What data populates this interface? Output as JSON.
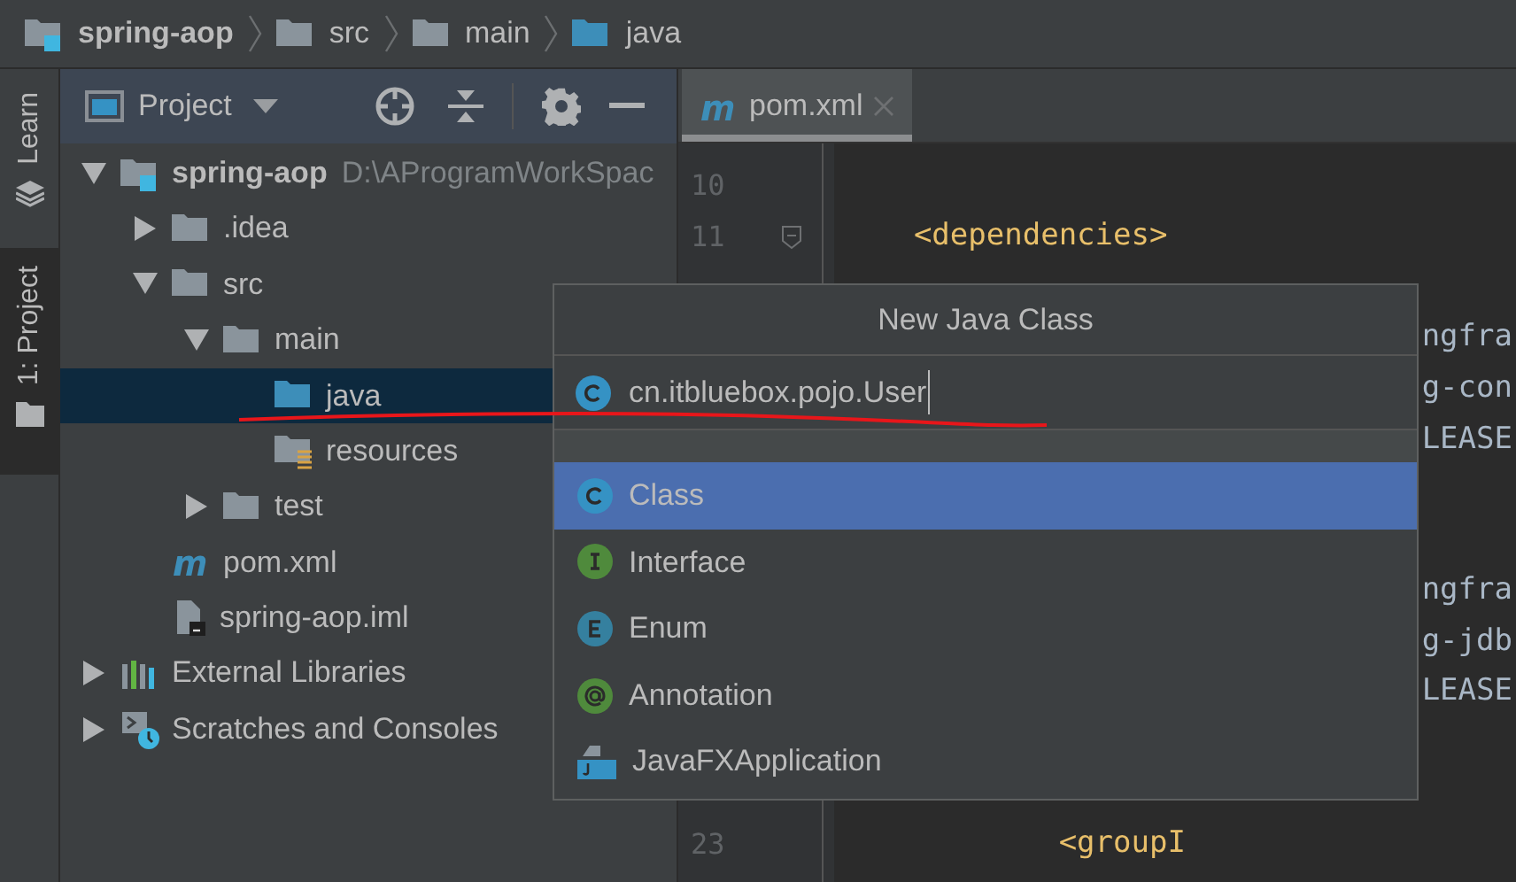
{
  "breadcrumbs": [
    {
      "label": "spring-aop",
      "kind": "module"
    },
    {
      "label": "src",
      "kind": "folder"
    },
    {
      "label": "main",
      "kind": "folder"
    },
    {
      "label": "java",
      "kind": "source"
    }
  ],
  "side_tabs": [
    {
      "label": "Learn",
      "kind": "learn",
      "selected": false
    },
    {
      "label": "1: Project",
      "kind": "project",
      "selected": true
    }
  ],
  "project_panel": {
    "title": "Project",
    "tree": [
      {
        "label": "spring-aop",
        "path": "D:\\AProgramWorkSpac",
        "kind": "module",
        "expanded": true,
        "selected": false,
        "children": [
          {
            "label": ".idea",
            "kind": "folder",
            "expanded": false,
            "selected": false
          },
          {
            "label": "src",
            "kind": "folder",
            "expanded": true,
            "selected": false,
            "children": [
              {
                "label": "main",
                "kind": "folder",
                "expanded": true,
                "selected": false,
                "children": [
                  {
                    "label": "java",
                    "kind": "source",
                    "selected": true
                  },
                  {
                    "label": "resources",
                    "kind": "resources",
                    "selected": false
                  }
                ]
              },
              {
                "label": "test",
                "kind": "folder",
                "expanded": false,
                "selected": false
              }
            ]
          },
          {
            "label": "pom.xml",
            "kind": "maven",
            "selected": false
          },
          {
            "label": "spring-aop.iml",
            "kind": "iml",
            "selected": false
          }
        ]
      },
      {
        "label": "External Libraries",
        "kind": "libraries",
        "expanded": false,
        "selected": false
      },
      {
        "label": "Scratches and Consoles",
        "kind": "scratches",
        "expanded": false,
        "selected": false
      }
    ]
  },
  "editor": {
    "tabs": [
      {
        "label": "pom.xml",
        "selected": true
      }
    ],
    "lines": [
      {
        "number": "10",
        "kind": "text"
      },
      {
        "number": "11",
        "text": "    <dependencies>",
        "kind": "tag",
        "fold": true
      },
      {
        "kind": "text"
      },
      {
        "text": "ngfra",
        "kind": "right"
      },
      {
        "text": "g-con",
        "kind": "right"
      },
      {
        "text": "LEASE",
        "kind": "right"
      },
      {
        "kind": "text"
      },
      {
        "kind": "text"
      },
      {
        "text": "ngfra",
        "kind": "right"
      },
      {
        "text": "g-jdb",
        "kind": "right"
      },
      {
        "text": "LEASE",
        "kind": "right"
      },
      {
        "kind": "text"
      },
      {
        "kind": "text"
      },
      {
        "number": "23",
        "text": "            <groupI",
        "kind": "tag"
      }
    ]
  },
  "dialog": {
    "title": "New Java Class",
    "value": "cn.itbluebox.pojo.User",
    "items": [
      {
        "label": "Class",
        "kind": "class",
        "selected": true
      },
      {
        "label": "Interface",
        "kind": "interface",
        "selected": false
      },
      {
        "label": "Enum",
        "kind": "enum",
        "selected": false
      },
      {
        "label": "Annotation",
        "kind": "annotation",
        "selected": false
      },
      {
        "label": "JavaFXApplication",
        "kind": "javafx",
        "selected": false
      }
    ]
  }
}
